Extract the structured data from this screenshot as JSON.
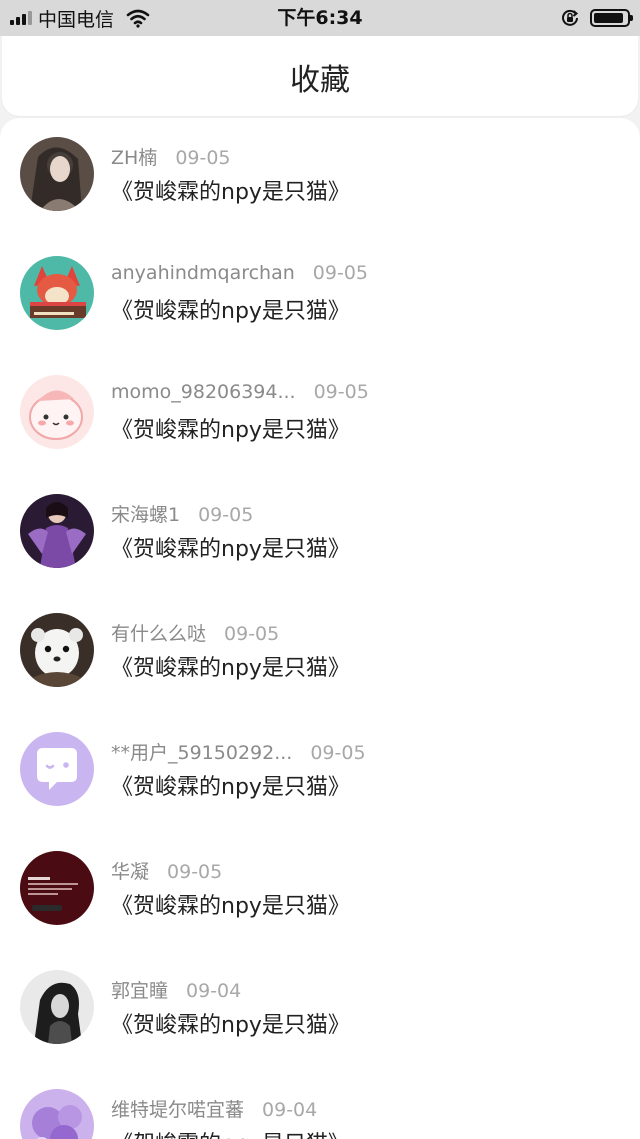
{
  "status_bar": {
    "carrier": "中国电信",
    "time": "下午6:34",
    "battery_level": 0.9
  },
  "header": {
    "title": "收藏"
  },
  "favorites": [
    {
      "user": "ZH楠",
      "date": "09-05",
      "title": "《贺峻霖的npy是只猫》",
      "avatar_icon": "photo-girl-avatar"
    },
    {
      "user": "anyahindmqarchan",
      "date": "09-05",
      "title": "《贺峻霖的npy是只猫》",
      "avatar_icon": "cartoon-fox-avatar"
    },
    {
      "user": "momo_98206394...",
      "date": "09-05",
      "title": "《贺峻霖的npy是只猫》",
      "avatar_icon": "pink-blob-avatar"
    },
    {
      "user": "宋海螺1",
      "date": "09-05",
      "title": "《贺峻霖的npy是只猫》",
      "avatar_icon": "purple-dress-avatar"
    },
    {
      "user": "有什么么哒",
      "date": "09-05",
      "title": "《贺峻霖的npy是只猫》",
      "avatar_icon": "ferret-avatar"
    },
    {
      "user": "**用户_59150292...",
      "date": "09-05",
      "title": "《贺峻霖的npy是只猫》",
      "avatar_icon": "default-chat-avatar"
    },
    {
      "user": "华凝",
      "date": "09-05",
      "title": "《贺峻霖的npy是只猫》",
      "avatar_icon": "dark-red-screenshot-avatar"
    },
    {
      "user": "郭宜瞳",
      "date": "09-04",
      "title": "《贺峻霖的npy是只猫》",
      "avatar_icon": "bw-photo-avatar"
    },
    {
      "user": "维特堤尔喏宜蕃",
      "date": "09-04",
      "title": "《贺峻霖的npy是只猫》",
      "avatar_icon": "purple-flower-avatar"
    }
  ]
}
